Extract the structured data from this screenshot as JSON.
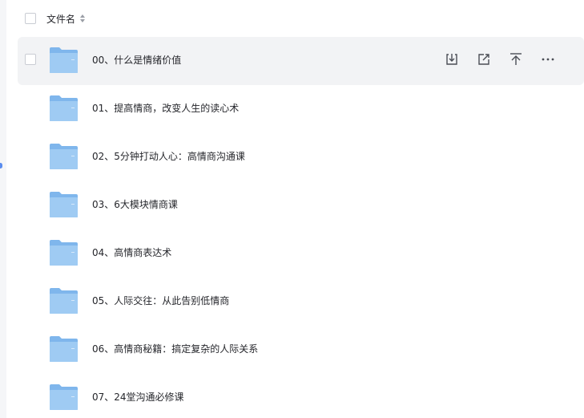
{
  "header": {
    "column_name": "文件名"
  },
  "files": [
    {
      "name": "00、什么是情绪价值",
      "type": "folder",
      "hovered": true
    },
    {
      "name": "01、提高情商，改变人生的读心术",
      "type": "folder"
    },
    {
      "name": "02、5分钟打动人心：高情商沟通课",
      "type": "folder"
    },
    {
      "name": "03、6大模块情商课",
      "type": "folder"
    },
    {
      "name": "04、高情商表达术",
      "type": "folder"
    },
    {
      "name": "05、人际交往：从此告别低情商",
      "type": "folder"
    },
    {
      "name": "06、高情商秘籍：搞定复杂的人际关系",
      "type": "folder"
    },
    {
      "name": "07、24堂沟通必修课",
      "type": "folder"
    }
  ],
  "row_actions": [
    "download-icon",
    "share-icon",
    "move-to-top-icon",
    "more-icon"
  ],
  "colors": {
    "folder_back": "#7fb6ec",
    "folder_front": "#9fcbf3",
    "hover_bg": "#f2f3f5",
    "icon": "#4a4d55"
  }
}
